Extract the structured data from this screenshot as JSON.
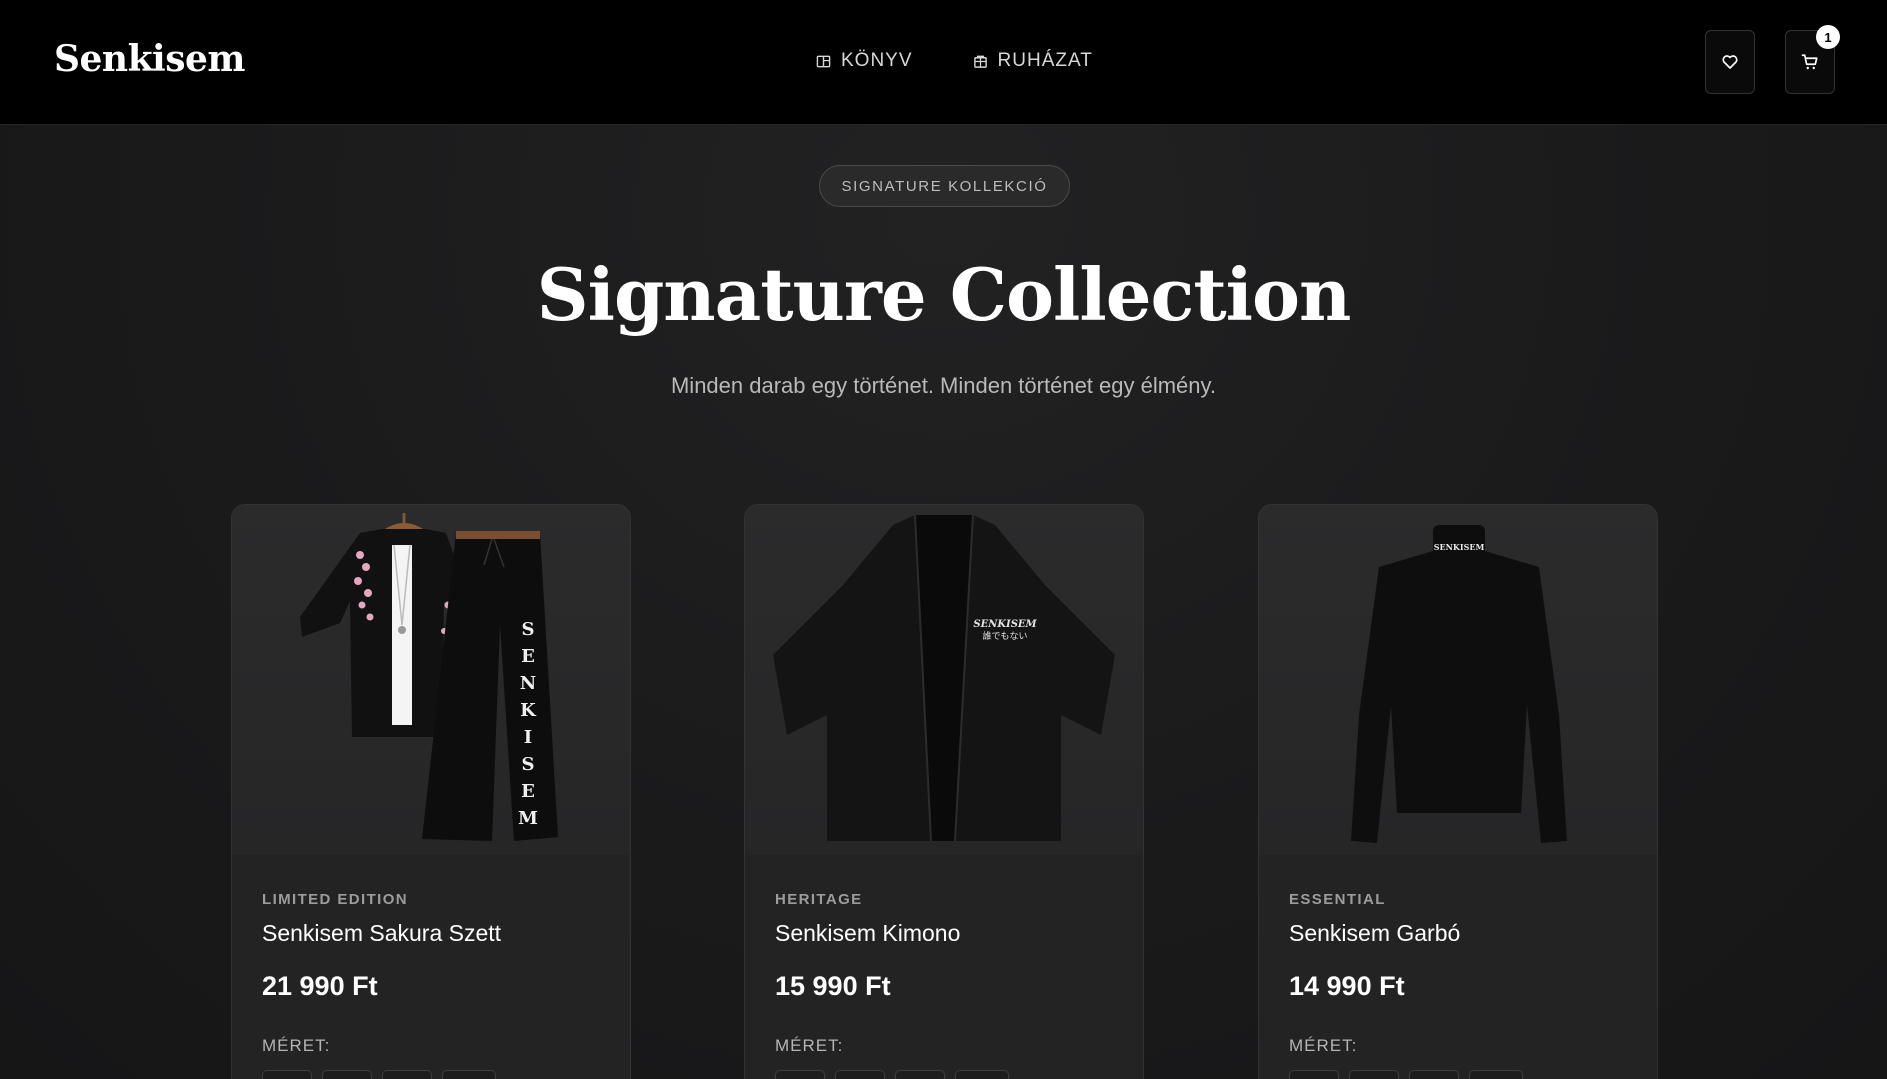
{
  "brand": {
    "logo": "Senkisem"
  },
  "nav": {
    "items": [
      {
        "label": "KÖNYV",
        "icon": "book-icon"
      },
      {
        "label": "RUHÁZAT",
        "icon": "shirt-icon"
      }
    ]
  },
  "header_actions": {
    "wishlist_icon": "heart-icon",
    "cart_icon": "cart-icon",
    "cart_count": "1"
  },
  "hero": {
    "badge": "SIGNATURE KOLLEKCIÓ",
    "title": "Signature Collection",
    "subtitle": "Minden darab egy történet. Minden történet egy élmény."
  },
  "products": [
    {
      "category": "LIMITED EDITION",
      "name": "Senkisem Sakura Szett",
      "price": "21 990 Ft",
      "size_label": "MÉRET:",
      "pants_text": "SENKISEM"
    },
    {
      "category": "HERITAGE",
      "name": "Senkisem Kimono",
      "price": "15 990 Ft",
      "size_label": "MÉRET:",
      "chest_text": "SENKISEM",
      "chest_subtext": "誰でもない"
    },
    {
      "category": "ESSENTIAL",
      "name": "Senkisem Garbó",
      "price": "14 990 Ft",
      "size_label": "MÉRET:",
      "collar_text": "SENKISEM"
    }
  ],
  "colors": {
    "header_bg": "#000000",
    "page_bg": "#1b1b1c",
    "card_bg": "#232324",
    "accent": "#ffffff"
  }
}
